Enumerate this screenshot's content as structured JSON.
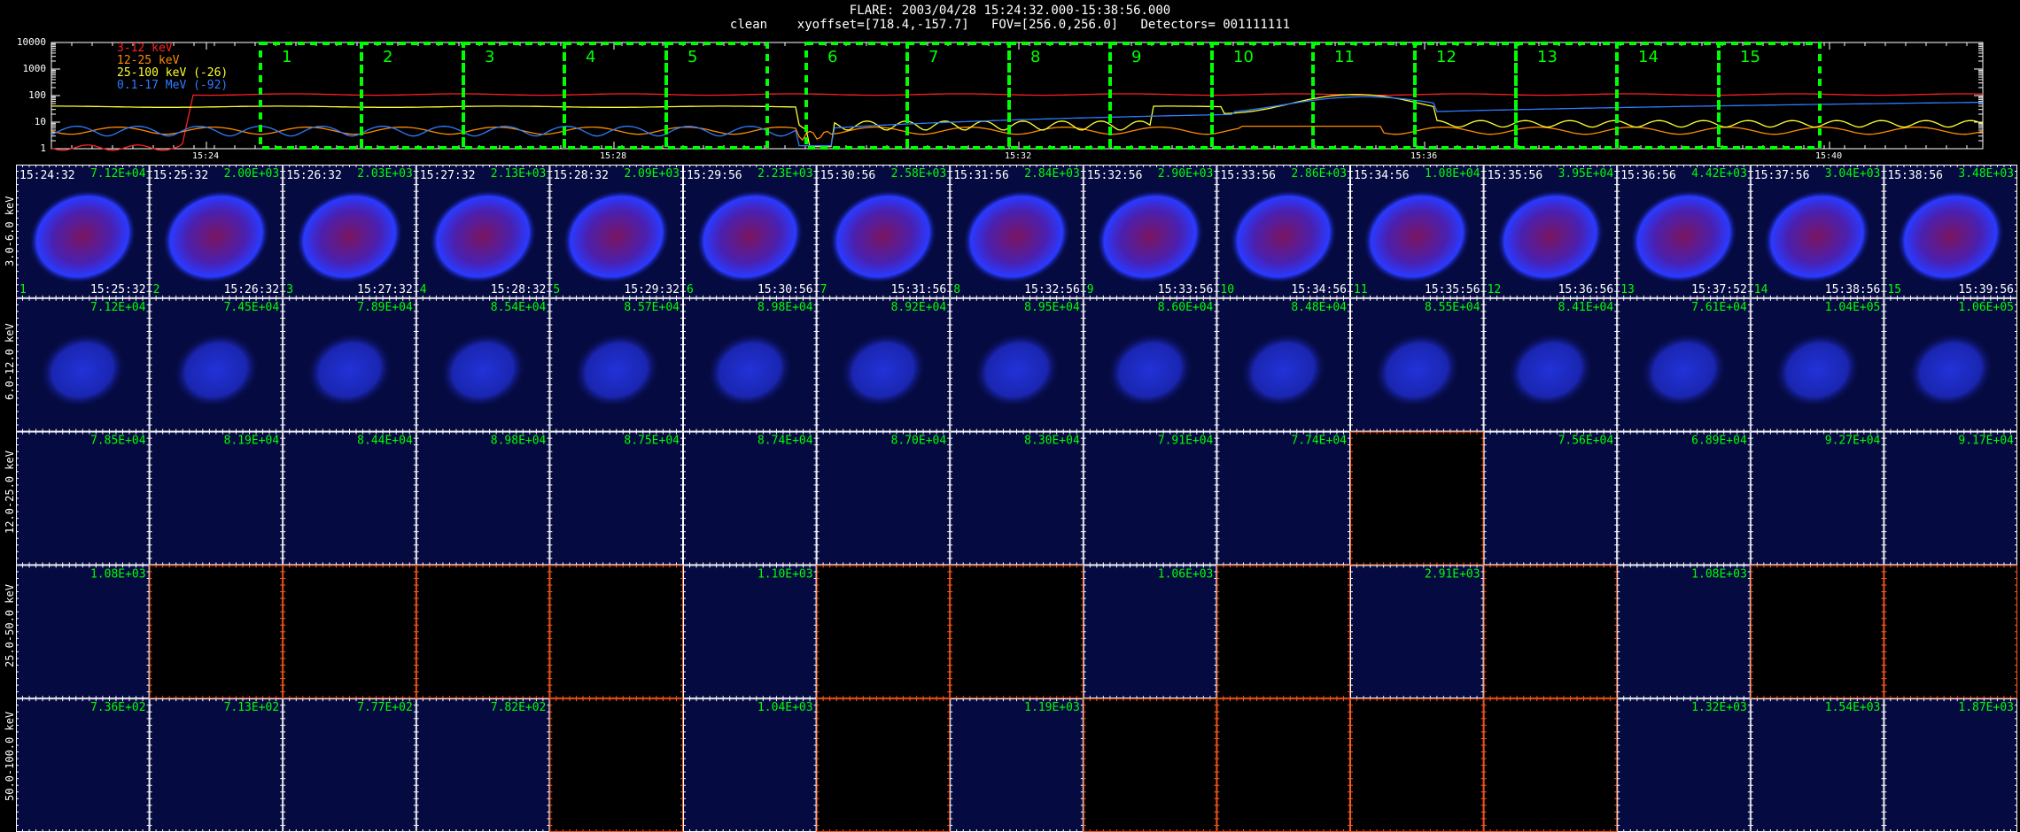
{
  "header": {
    "line1": "FLARE: 2003/04/28 15:24:32.000-15:38:56.000",
    "line2": "clean    xyoffset=[718.4,-157.7]   FOV=[256.0,256.0]   Detectors= 001111111"
  },
  "lightcurve": {
    "y_ticks": [
      "10000",
      "1000",
      "100",
      "10",
      "1"
    ],
    "x_ticks": [
      "15:24",
      "15:28",
      "15:32",
      "15:36",
      "15:40"
    ],
    "legend": [
      {
        "label": "3-12 keV",
        "color": "#ff2020"
      },
      {
        "label": "12-25 keV",
        "color": "#ff8c00"
      },
      {
        "label": "25-100 keV (-26)",
        "color": "#ffff30"
      },
      {
        "label": "0.1-17 MeV (-92)",
        "color": "#2f7bff"
      }
    ],
    "interval_labels": [
      "1",
      "2",
      "3",
      "4",
      "5",
      "6",
      "7",
      "8",
      "9",
      "10",
      "11",
      "12",
      "13",
      "14",
      "15"
    ],
    "interval_color": "#00ff00"
  },
  "energy_bands": [
    "3.0-6.0 keV",
    "6.0-12.0 keV",
    "12.0-25.0 keV",
    "25.0-50.0 keV",
    "50.0-100.0 keV"
  ],
  "start_times": [
    "15:24:32",
    "15:25:32",
    "15:26:32",
    "15:27:32",
    "15:28:32",
    "15:29:56",
    "15:30:56",
    "15:31:56",
    "15:32:56",
    "15:33:56",
    "15:34:56",
    "15:35:56",
    "15:36:56",
    "15:37:56",
    "15:38:56"
  ],
  "end_times": [
    "15:25:32",
    "15:26:32",
    "15:27:32",
    "15:28:32",
    "15:29:32",
    "15:30:56",
    "15:31:56",
    "15:32:56",
    "15:33:56",
    "15:34:56",
    "15:35:56",
    "15:36:56",
    "15:37:52",
    "15:38:56",
    "15:39:56"
  ],
  "peaks": [
    [
      "7.12E+04",
      "2.00E+03",
      "2.03E+03",
      "2.13E+03",
      "2.09E+03",
      "2.23E+03",
      "2.58E+03",
      "2.84E+03",
      "2.90E+03",
      "2.86E+03",
      "1.08E+04",
      "3.95E+04",
      "4.42E+03",
      "3.04E+03",
      "3.48E+03"
    ],
    [
      "7.12E+04",
      "7.45E+04",
      "7.89E+04",
      "8.54E+04",
      "8.57E+04",
      "8.98E+04",
      "8.92E+04",
      "8.95E+04",
      "8.60E+04",
      "8.48E+04",
      "8.55E+04",
      "8.41E+04",
      "7.61E+04",
      "1.04E+05",
      "1.06E+05"
    ],
    [
      "7.85E+04",
      "8.19E+04",
      "8.44E+04",
      "8.98E+04",
      "8.75E+04",
      "8.74E+04",
      "8.70E+04",
      "8.30E+04",
      "7.91E+04",
      "7.74E+04",
      "",
      "7.56E+04",
      "6.89E+04",
      "9.27E+04",
      "9.17E+04"
    ],
    [
      "1.08E+03",
      "",
      "",
      "",
      "",
      "1.10E+03",
      "",
      "",
      "1.06E+03",
      "",
      "2.91E+03",
      "",
      "1.08E+03",
      "",
      ""
    ],
    [
      "7.36E+02",
      "7.13E+02",
      "7.77E+02",
      "7.82E+02",
      "",
      "1.04E+03",
      "",
      "1.19E+03",
      "",
      "",
      "",
      "",
      "1.32E+03",
      "1.54E+03",
      "1.87E+03"
    ]
  ],
  "colors": {
    "image_bg": "#050a40",
    "blob_row1_center": "#7a1560",
    "blob_row1_edge": "#2a3aff",
    "blob_row2": "#2232d8",
    "empty_axis": "#ff5a1f",
    "time_text": "#ffffff",
    "peak_text": "#00ff00"
  }
}
